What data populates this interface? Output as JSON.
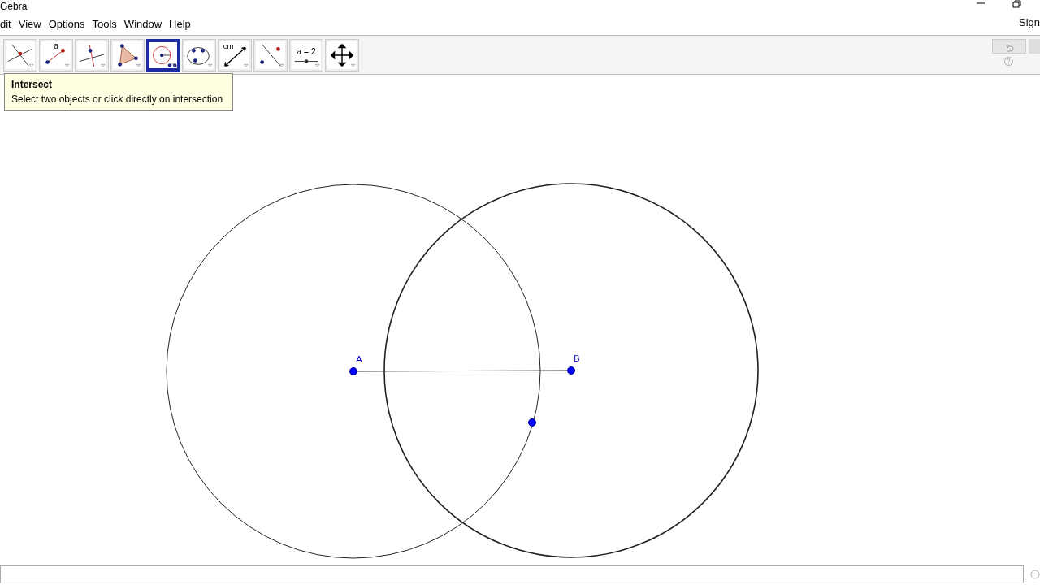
{
  "window": {
    "title": "Gebra"
  },
  "menu": [
    "dit",
    "View",
    "Options",
    "Tools",
    "Window",
    "Help"
  ],
  "sign_in": "Sign",
  "toolbar": [
    {
      "kind": "intersect",
      "selected": false
    },
    {
      "kind": "point-on",
      "label": "a",
      "selected": false
    },
    {
      "kind": "perpendicular",
      "selected": false
    },
    {
      "kind": "polygon",
      "selected": false
    },
    {
      "kind": "circle",
      "selected": true
    },
    {
      "kind": "conic",
      "selected": false
    },
    {
      "kind": "measure",
      "label": "cm",
      "selected": false
    },
    {
      "kind": "reflect",
      "selected": false
    },
    {
      "kind": "slider",
      "label": "a = 2",
      "selected": false
    },
    {
      "kind": "move-view",
      "selected": false
    }
  ],
  "tooltip": {
    "title": "Intersect",
    "text": "Select two objects or click directly on intersection"
  },
  "points": [
    {
      "label": "A"
    },
    {
      "label": "B"
    }
  ]
}
